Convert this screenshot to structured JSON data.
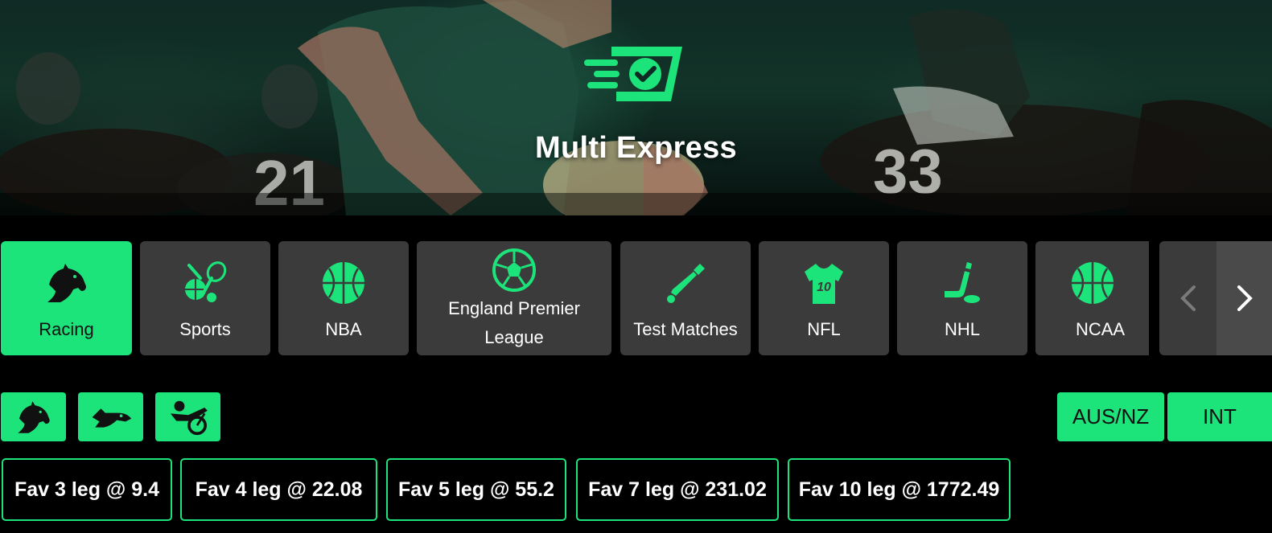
{
  "hero": {
    "title": "Multi Express"
  },
  "categories": [
    {
      "label": "Racing",
      "icon": "horse-head-icon",
      "active": true
    },
    {
      "label": "Sports",
      "icon": "sports-equipment-icon",
      "active": false
    },
    {
      "label": "NBA",
      "icon": "basketball-icon",
      "active": false
    },
    {
      "label": "England Premier League",
      "icon": "soccer-ball-icon",
      "active": false
    },
    {
      "label": "Test Matches",
      "icon": "cricket-bat-icon",
      "active": false
    },
    {
      "label": "NFL",
      "icon": "jersey-icon",
      "jersey_number": "10",
      "active": false
    },
    {
      "label": "NHL",
      "icon": "hockey-stick-icon",
      "active": false
    },
    {
      "label": "NCAA",
      "icon": "basketball-icon",
      "active": false
    }
  ],
  "race_types": [
    {
      "icon": "horse-head-icon"
    },
    {
      "icon": "greyhound-icon"
    },
    {
      "icon": "harness-racing-icon"
    }
  ],
  "regions": [
    {
      "label": "AUS/NZ"
    },
    {
      "label": "INT"
    }
  ],
  "favourites": [
    {
      "label": "Fav 3 leg @ 9.4"
    },
    {
      "label": "Fav 4 leg @ 22.08"
    },
    {
      "label": "Fav 5 leg @ 55.2"
    },
    {
      "label": "Fav 7 leg @ 231.02"
    },
    {
      "label": "Fav 10 leg @ 1772.49"
    }
  ],
  "colors": {
    "accent": "#1de37b",
    "tile": "#3b3b3b",
    "background": "#000000"
  }
}
